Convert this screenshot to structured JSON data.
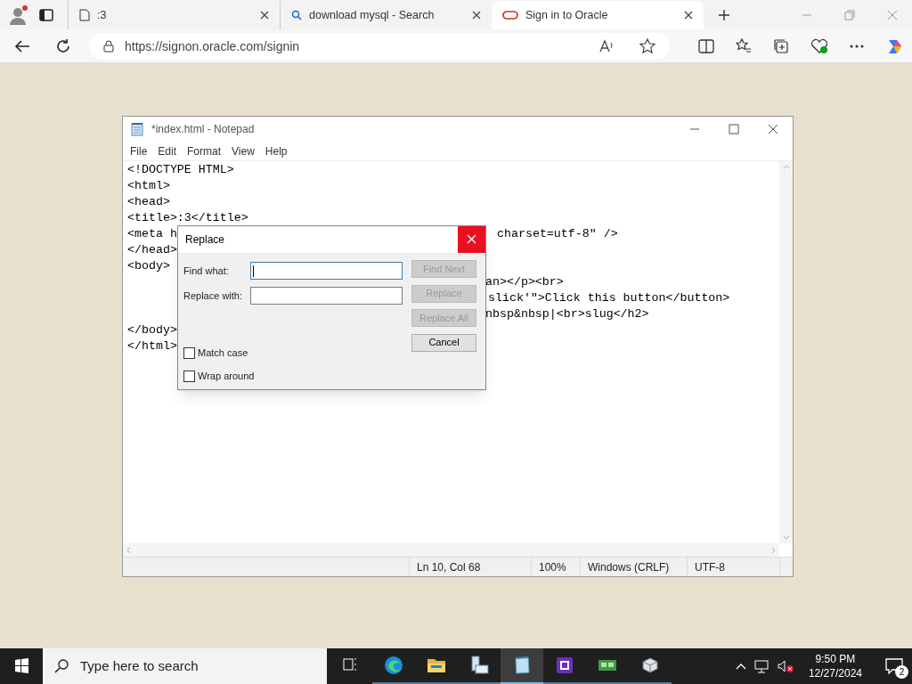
{
  "browser": {
    "tabs": [
      {
        "title": ":3",
        "kind": "page",
        "selected": false
      },
      {
        "title": "download mysql - Search",
        "kind": "search",
        "selected": false
      },
      {
        "title": "Sign in to Oracle",
        "kind": "oracle",
        "selected": true
      }
    ],
    "address": "https://signon.oracle.com/signin"
  },
  "notepad": {
    "title": "*index.html - Notepad",
    "menu": [
      "File",
      "Edit",
      "Format",
      "View",
      "Help"
    ],
    "lines": [
      {
        "left": "<!DOCTYPE HTML>"
      },
      {
        "left": "<html>"
      },
      {
        "left": "<head>"
      },
      {
        "left": "<title>:3</title>"
      },
      {
        "left": "<meta h",
        "right": "charset=utf-8\" />"
      },
      {
        "left": "</head>"
      },
      {
        "left": "<body>"
      },
      {
        "right": "an></p><br>"
      },
      {
        "right": "slick'\">Click this button</button>"
      },
      {
        "right": "nbsp&nbsp|<br>slug</h2>"
      },
      {
        "left": "</body>"
      },
      {
        "left": "</html>"
      }
    ],
    "status_bar": [
      "Ln 10, Col 68",
      "100%",
      "Windows (CRLF)",
      "UTF-8"
    ]
  },
  "replace_dialog": {
    "title": "Replace",
    "fields": [
      {
        "label": "Find what:",
        "focused": true
      },
      {
        "label": "Replace with:",
        "focused": false
      }
    ],
    "buttons": [
      {
        "label": "Find Next",
        "disabled": true
      },
      {
        "label": "Replace",
        "disabled": true
      },
      {
        "label": "Replace All",
        "disabled": true
      },
      {
        "label": "Cancel",
        "disabled": false
      }
    ],
    "checkboxes": [
      {
        "label": "Match case",
        "checked": false
      },
      {
        "label": "Wrap around",
        "checked": false
      }
    ]
  },
  "taskbar": {
    "search_placeholder": "Type here to search",
    "apps": [
      {
        "kind": "taskview",
        "active": false
      },
      {
        "kind": "edge",
        "active": false
      },
      {
        "kind": "folder",
        "active": false
      },
      {
        "kind": "server",
        "active": false
      },
      {
        "kind": "notepad",
        "active": true
      },
      {
        "kind": "chip",
        "active": false
      },
      {
        "kind": "card",
        "active": false
      },
      {
        "kind": "cloud",
        "active": false
      }
    ],
    "time": "9:50 PM",
    "date": "12/27/2024",
    "notifications": "2"
  }
}
